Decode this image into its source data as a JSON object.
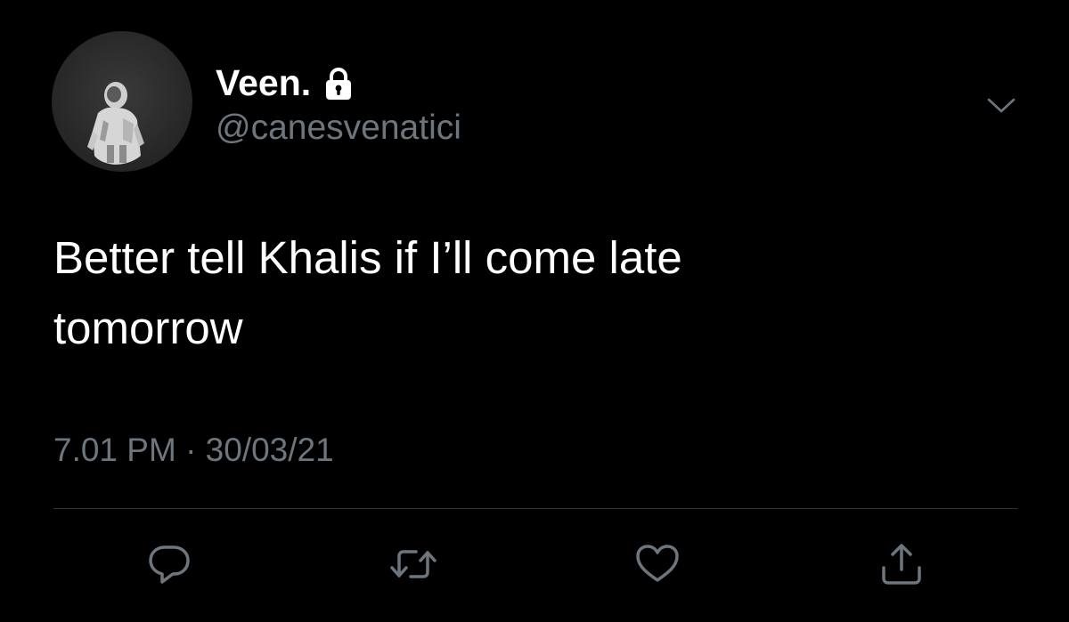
{
  "tweet": {
    "display_name": "Veen.",
    "handle": "@canesvenatici",
    "text_line1": "Better tell Khalis if I’ll come late",
    "text_line2": "tomorrow",
    "timestamp": "7.01 PM · 30/03/21",
    "protected": true
  },
  "icons": {
    "avatar": "avatar-image",
    "lock": "lock-icon",
    "menu": "chevron-down-icon",
    "reply": "reply-icon",
    "retweet": "retweet-icon",
    "like": "heart-icon",
    "share": "share-icon"
  },
  "colors": {
    "background": "#000000",
    "primary_text": "#ffffff",
    "secondary_text": "#6e767d",
    "divider": "#2f3336"
  }
}
